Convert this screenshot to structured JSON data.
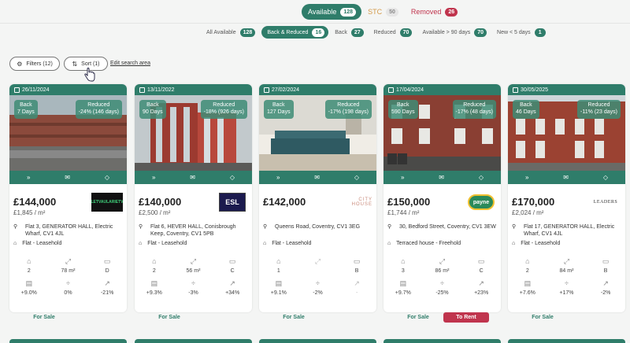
{
  "status_tabs": [
    {
      "label": "Available",
      "count": "128"
    },
    {
      "label": "STC",
      "count": "50"
    },
    {
      "label": "Removed",
      "count": "26"
    }
  ],
  "sub_tabs": [
    {
      "label": "All Available",
      "count": "128"
    },
    {
      "label": "Back & Reduced",
      "count": "16"
    },
    {
      "label": "Back",
      "count": "27"
    },
    {
      "label": "Reduced",
      "count": "70"
    },
    {
      "label": "Available > 90 days",
      "count": "70"
    },
    {
      "label": "New < 5 days",
      "count": "1"
    }
  ],
  "toolbar": {
    "filters_label": "Filters (12)",
    "sort_label": "Sort (1)",
    "edit_search_label": "Edit search area"
  },
  "colors": {
    "accent": "#2f7d6a",
    "stc": "#d49a4a",
    "removed": "#c0344d"
  },
  "cards": [
    {
      "date": "26/11/2024",
      "back_title": "Back",
      "back_detail": "7 Days",
      "reduced_title": "Reduced",
      "reduced_detail": "-24% (146 days)",
      "price": "£144,000",
      "ppm": "£1,845 / m²",
      "agent": "LETVAULARIETV",
      "address": "Flat 3, GENERATOR HALL, Electric Wharf, CV1 4JL",
      "property_type": "Flat - Leasehold",
      "beds": "2",
      "area": "78 m²",
      "epc": "D",
      "growth": "+9.0%",
      "change": "0%",
      "trend": "-21%",
      "tags": [
        "For Sale"
      ]
    },
    {
      "date": "13/11/2022",
      "back_title": "Back",
      "back_detail": "90 Days",
      "reduced_title": "Reduced",
      "reduced_detail": "-18% (926 days)",
      "price": "£140,000",
      "ppm": "£2,500 / m²",
      "agent": "ESL",
      "address": "Flat 6, HEVER HALL, Conisbrough Keep, Coventry, CV1 5PB",
      "property_type": "Flat - Leasehold",
      "beds": "2",
      "area": "56 m²",
      "epc": "C",
      "growth": "+9.3%",
      "change": "-3%",
      "trend": "+34%",
      "tags": [
        "For Sale"
      ]
    },
    {
      "date": "27/02/2024",
      "back_title": "Back",
      "back_detail": "127 Days",
      "reduced_title": "Reduced",
      "reduced_detail": "-17% (198 days)",
      "price": "£142,000",
      "ppm": "",
      "agent": "CITY HOUSE",
      "address": "Queens Road, Coventry, CV1 3EG",
      "property_type": "Flat - Leasehold",
      "beds": "1",
      "area": "",
      "epc": "B",
      "growth": "+9.1%",
      "change": "-2%",
      "trend": "-",
      "tags": [
        "For Sale"
      ]
    },
    {
      "date": "17/04/2024",
      "back_title": "Back",
      "back_detail": "590 Days",
      "reduced_title": "Reduced",
      "reduced_detail": "-17% (48 days)",
      "price": "£150,000",
      "ppm": "£1,744 / m²",
      "agent": "payne",
      "address": "30, Bedford Street, Coventry, CV1 3EW",
      "property_type": "Terraced house - Freehold",
      "beds": "3",
      "area": "86 m²",
      "epc": "C",
      "growth": "+9.7%",
      "change": "-25%",
      "trend": "+23%",
      "tags": [
        "For Sale",
        "To Rent"
      ]
    },
    {
      "date": "30/05/2025",
      "back_title": "Back",
      "back_detail": "46 Days",
      "reduced_title": "Reduced",
      "reduced_detail": "-11% (23 days)",
      "price": "£170,000",
      "ppm": "£2,024 / m²",
      "agent": "LEADERS",
      "address": "Flat 17, GENERATOR HALL, Electric Wharf, CV1 4JL",
      "property_type": "Flat - Leasehold",
      "beds": "2",
      "area": "84 m²",
      "epc": "B",
      "growth": "+7.6%",
      "change": "+17%",
      "trend": "-2%",
      "tags": [
        "For Sale"
      ]
    }
  ]
}
